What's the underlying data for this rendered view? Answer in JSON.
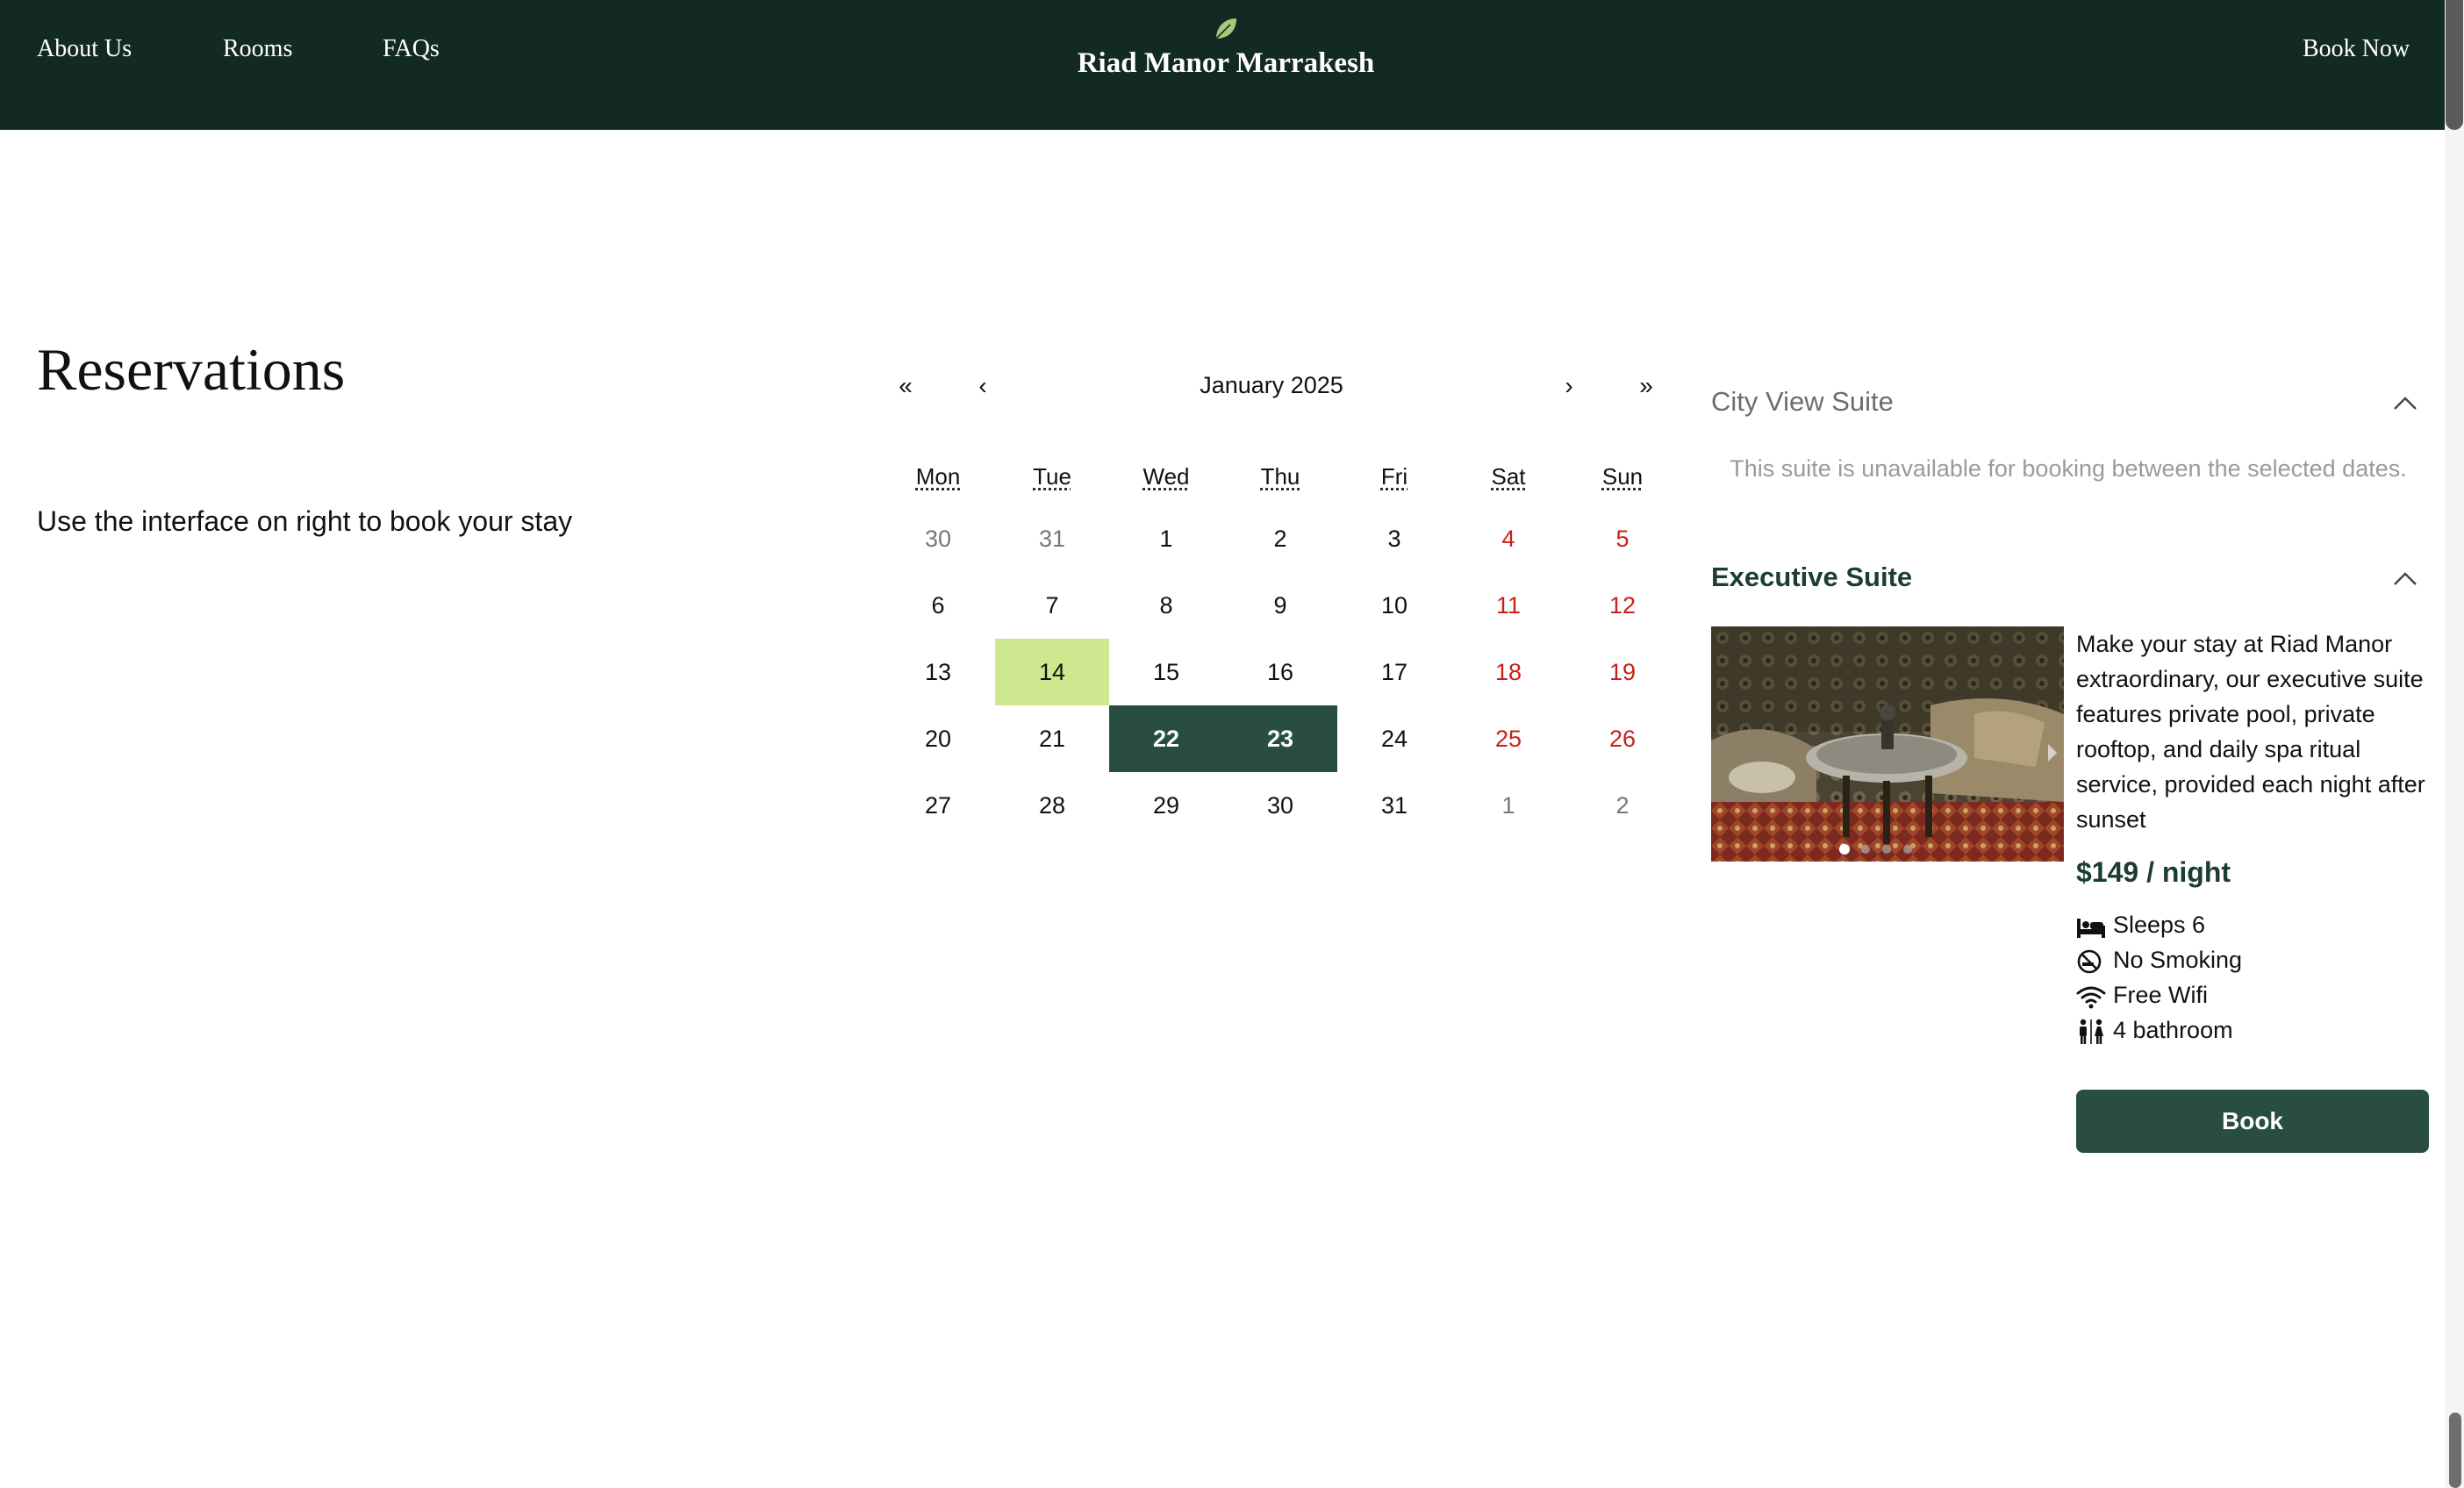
{
  "nav": {
    "links": [
      "About Us",
      "Rooms",
      "FAQs"
    ],
    "brand": "Riad Manor Marrakesh",
    "book_now": "Book Now",
    "bg_color": "#132a24"
  },
  "main": {
    "title": "Reservations",
    "subtitle": "Use the interface on right to book your stay"
  },
  "calendar": {
    "first_label": "«",
    "prev_label": "‹",
    "next_label": "›",
    "last_label": "»",
    "month": "January 2025",
    "weekdays": [
      "Mon",
      "Tue",
      "Wed",
      "Thu",
      "Fri",
      "Sat",
      "Sun"
    ],
    "weeks": [
      [
        "30",
        "31",
        "1",
        "2",
        "3",
        "4",
        "5"
      ],
      [
        "6",
        "7",
        "8",
        "9",
        "10",
        "11",
        "12"
      ],
      [
        "13",
        "14",
        "15",
        "16",
        "17",
        "18",
        "19"
      ],
      [
        "20",
        "21",
        "22",
        "23",
        "24",
        "25",
        "26"
      ],
      [
        "27",
        "28",
        "29",
        "30",
        "31",
        "1",
        "2"
      ]
    ],
    "today_color": "#cde88f",
    "selected_color": "#2a4d43",
    "weekend_color": "#c8211c"
  },
  "suites": {
    "city_view": {
      "name": "City View Suite",
      "message": "This suite is unavailable for booking between the selected dates."
    },
    "executive": {
      "name": "Executive Suite",
      "description": "Make your stay at Riad Manor extraordinary, our executive suite features private pool, private rooftop, and daily spa ritual service, provided each night after sunset",
      "price": "$149 / night",
      "features": [
        {
          "icon": "bed-icon",
          "label": "Sleeps 6"
        },
        {
          "icon": "no-smoking-icon",
          "label": "No Smoking"
        },
        {
          "icon": "wifi-icon",
          "label": "Free Wifi"
        },
        {
          "icon": "restroom-icon",
          "label": "4 bathroom"
        }
      ],
      "book_label": "Book",
      "carousel_slides": 4,
      "carousel_active_slide": 1
    }
  }
}
